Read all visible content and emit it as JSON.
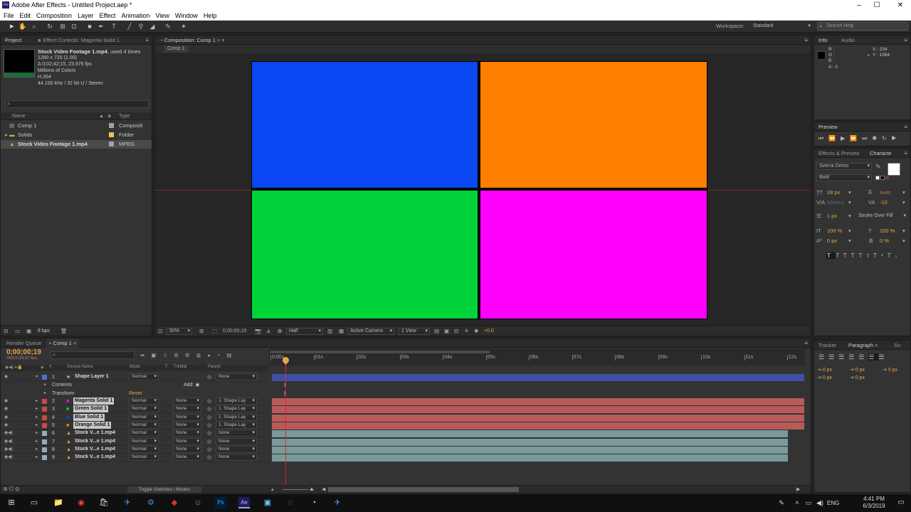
{
  "window": {
    "title": "Adobe After Effects - Untitled Project.aep *",
    "app_icon": "Ae"
  },
  "menu": [
    "File",
    "Edit",
    "Composition",
    "Layer",
    "Effect",
    "Animation",
    "View",
    "Window",
    "Help"
  ],
  "workspace": {
    "label": "Workspace:",
    "value": "Standard"
  },
  "search_help": {
    "placeholder": "Search Help"
  },
  "project_panel": {
    "tabs": [
      "Project",
      "Effect Controls: Magenta Solid 1"
    ],
    "footage_name": "Stock Video Footage 1.mp4",
    "footage_used": ", used 4 times",
    "info_lines": [
      "1280 x 720 (1.00)",
      "Δ 0;02;42;15, 23.976 fps",
      "Millions of Colors",
      "H.264",
      "44.100 kHz / 32 bit U / Stereo"
    ],
    "columns": {
      "name": "Name",
      "type": "Type"
    },
    "items": [
      {
        "name": "Comp 1",
        "type": "Compositi",
        "icon": "composition-icon",
        "color": "#a3a3a3"
      },
      {
        "name": "Solids",
        "type": "Folder",
        "icon": "folder-icon",
        "color": "#e6c84a"
      },
      {
        "name": "Stock Video Footage 1.mp4",
        "type": "MPEG",
        "icon": "footage-icon",
        "color": "#a3a3a3"
      }
    ],
    "bpc": "8 bpc"
  },
  "composition_panel": {
    "tab": "Composition: Comp 1",
    "sub_tab": "Comp 1",
    "zoom": "50%",
    "timecode": "0;00;00;19",
    "resolution": "Half",
    "camera": "Active Camera",
    "view": "1 View",
    "exposure": "+0.0",
    "rects": [
      {
        "name": "blue-solid",
        "color": "#0a47f2"
      },
      {
        "name": "orange-solid",
        "color": "#ff8000"
      },
      {
        "name": "green-solid",
        "color": "#00d23a"
      },
      {
        "name": "magenta-solid",
        "color": "#ff00ff"
      }
    ]
  },
  "info_panel": {
    "tabs": [
      "Info",
      "Audio"
    ],
    "r": "R :",
    "g": "G :",
    "b": "B :",
    "a": "A : 0",
    "x": "X : 234",
    "y": "Y : 1084"
  },
  "preview_panel": {
    "tab": "Preview"
  },
  "effects_panel": {
    "tabs": [
      "Effects & Presets",
      "Characte"
    ],
    "font": "Sverra Demo",
    "style": "Bold",
    "font_size": "28 px",
    "leading": "Auto",
    "kerning": "Metrics",
    "tracking": "-10",
    "stroke_width": "1 px",
    "stroke_type": "Stroke Over Fill",
    "vscale": "100 %",
    "hscale": "100 %",
    "baseline": "0 px",
    "tsume": "0 %"
  },
  "paragraph_panel": {
    "tabs": [
      "Tracker",
      "Paragraph",
      "Sn"
    ],
    "indent_values": [
      "0 px",
      "0 px",
      "0 px",
      "0 px",
      "0 px"
    ]
  },
  "timeline": {
    "tabs": [
      "Render Queue",
      "Comp 1"
    ],
    "timecode": "0;00;00;19",
    "timecode_sub": "00019 (29.97 fps)",
    "columns": {
      "source": "Source Name",
      "mode": "Mode",
      "t": "T",
      "trkmat": "TrkMat",
      "parent": "Parent"
    },
    "ruler": [
      "0:00s",
      "01s",
      "02s",
      "03s",
      "04s",
      "05s",
      "06s",
      "07s",
      "08s",
      "09s",
      "10s",
      "11s",
      "12s"
    ],
    "layers": [
      {
        "num": "1",
        "name": "Shape Layer 1",
        "mode": "Normal",
        "trkmat": "",
        "parent": "None",
        "color": "#5a6bd6",
        "bar": "#3f4fa8",
        "type": "shape"
      },
      {
        "num": "2",
        "name": "Magenta Solid 1",
        "mode": "Normal",
        "trkmat": "None",
        "parent": "1. Shape Lay",
        "color": "#ff00ff",
        "bar": "#b85a5a",
        "type": "solid"
      },
      {
        "num": "3",
        "name": "Green Solid 1",
        "mode": "Normal",
        "trkmat": "None",
        "parent": "1. Shape Lay",
        "color": "#00d23a",
        "bar": "#b85a5a",
        "type": "solid"
      },
      {
        "num": "4",
        "name": "Blue Solid 1",
        "mode": "Normal",
        "trkmat": "None",
        "parent": "1. Shape Lay",
        "color": "#0a47f2",
        "bar": "#b85a5a",
        "type": "solid"
      },
      {
        "num": "5",
        "name": "Orange Solid 1",
        "mode": "Normal",
        "trkmat": "None",
        "parent": "1. Shape Lay",
        "color": "#ff8000",
        "bar": "#b85a5a",
        "type": "solid"
      },
      {
        "num": "6",
        "name": "Stock V...e 1.mp4",
        "mode": "Normal",
        "trkmat": "None",
        "parent": "None",
        "color": "#a3a3a3",
        "bar": "#7a9a9a",
        "type": "footage"
      },
      {
        "num": "7",
        "name": "Stock V...e 1.mp4",
        "mode": "Normal",
        "trkmat": "None",
        "parent": "None",
        "color": "#a3a3a3",
        "bar": "#7a9a9a",
        "type": "footage"
      },
      {
        "num": "8",
        "name": "Stock V...e 1.mp4",
        "mode": "Normal",
        "trkmat": "None",
        "parent": "None",
        "color": "#a3a3a3",
        "bar": "#7a9a9a",
        "type": "footage"
      },
      {
        "num": "9",
        "name": "Stock V...e 1.mp4",
        "mode": "Normal",
        "trkmat": "None",
        "parent": "None",
        "color": "#a3a3a3",
        "bar": "#7a9a9a",
        "type": "footage"
      }
    ],
    "contents_label": "Contents",
    "transform_label": "Transform",
    "add_label": "Add:",
    "reset_label": "Reset",
    "toggle_label": "Toggle Switches / Modes"
  },
  "taskbar": {
    "time": "4:41 PM",
    "date": "6/3/2019",
    "lang": "ENG"
  }
}
